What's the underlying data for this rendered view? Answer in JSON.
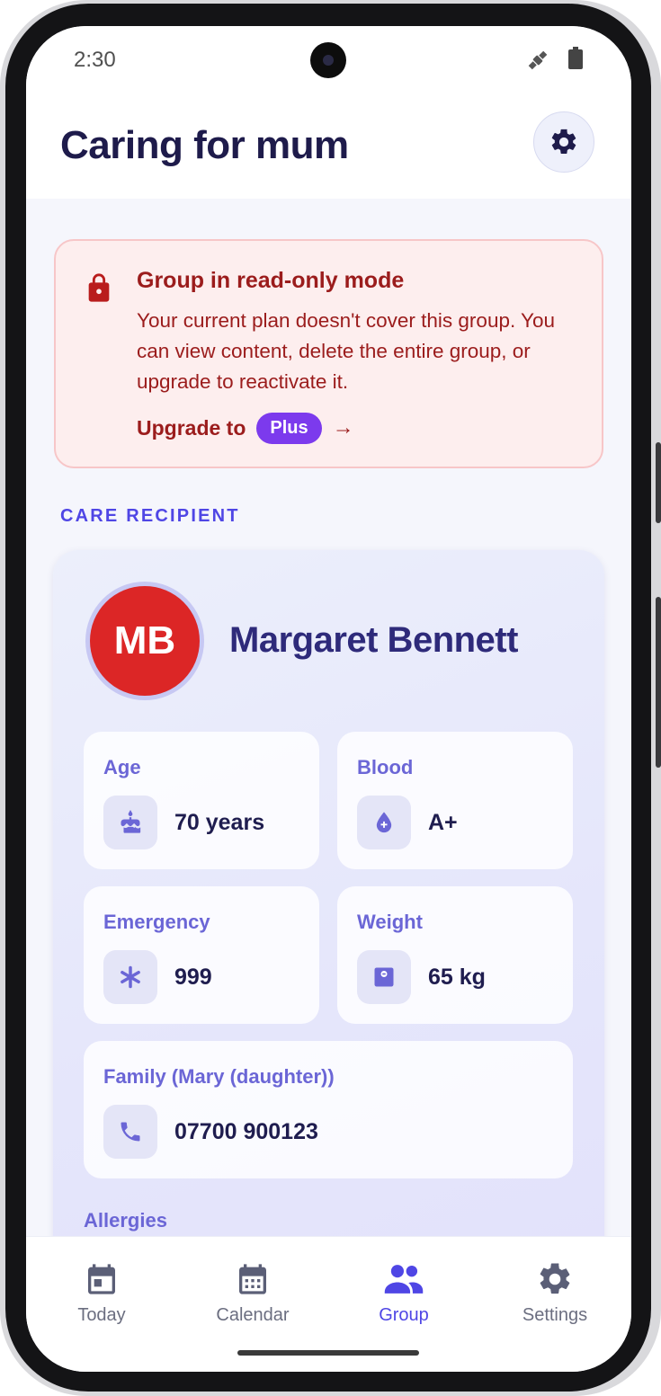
{
  "status_bar": {
    "time": "2:30"
  },
  "header": {
    "title": "Caring for mum"
  },
  "alert": {
    "title": "Group in read-only mode",
    "body": "Your current plan doesn't cover this group. You can view content, delete the entire group, or upgrade to reactivate it.",
    "upgrade_label": "Upgrade to",
    "plan_badge": "Plus",
    "arrow": "→"
  },
  "section": {
    "label": "CARE RECIPIENT"
  },
  "recipient": {
    "initials": "MB",
    "name": "Margaret Bennett",
    "avatar_color": "#dc2626",
    "tiles": [
      {
        "label": "Age",
        "value": "70 years",
        "icon": "cake-icon"
      },
      {
        "label": "Blood",
        "value": "A+",
        "icon": "blood-drop-icon"
      },
      {
        "label": "Emergency",
        "value": "999",
        "icon": "asterisk-icon"
      },
      {
        "label": "Weight",
        "value": "65 kg",
        "icon": "scale-icon"
      },
      {
        "label": "Family (Mary (daughter))",
        "value": "07700 900123",
        "icon": "phone-icon"
      }
    ],
    "allergies_label": "Allergies"
  },
  "bottom_nav": {
    "items": [
      {
        "label": "Today",
        "icon": "today-icon"
      },
      {
        "label": "Calendar",
        "icon": "calendar-icon"
      },
      {
        "label": "Group",
        "icon": "group-icon",
        "active": true
      },
      {
        "label": "Settings",
        "icon": "settings-icon"
      }
    ]
  },
  "colors": {
    "accent": "#4f46e5",
    "title": "#1e1b4b",
    "alert_text": "#9b1c1c",
    "alert_bg": "#fdeeee",
    "badge": "#7c3aed"
  }
}
